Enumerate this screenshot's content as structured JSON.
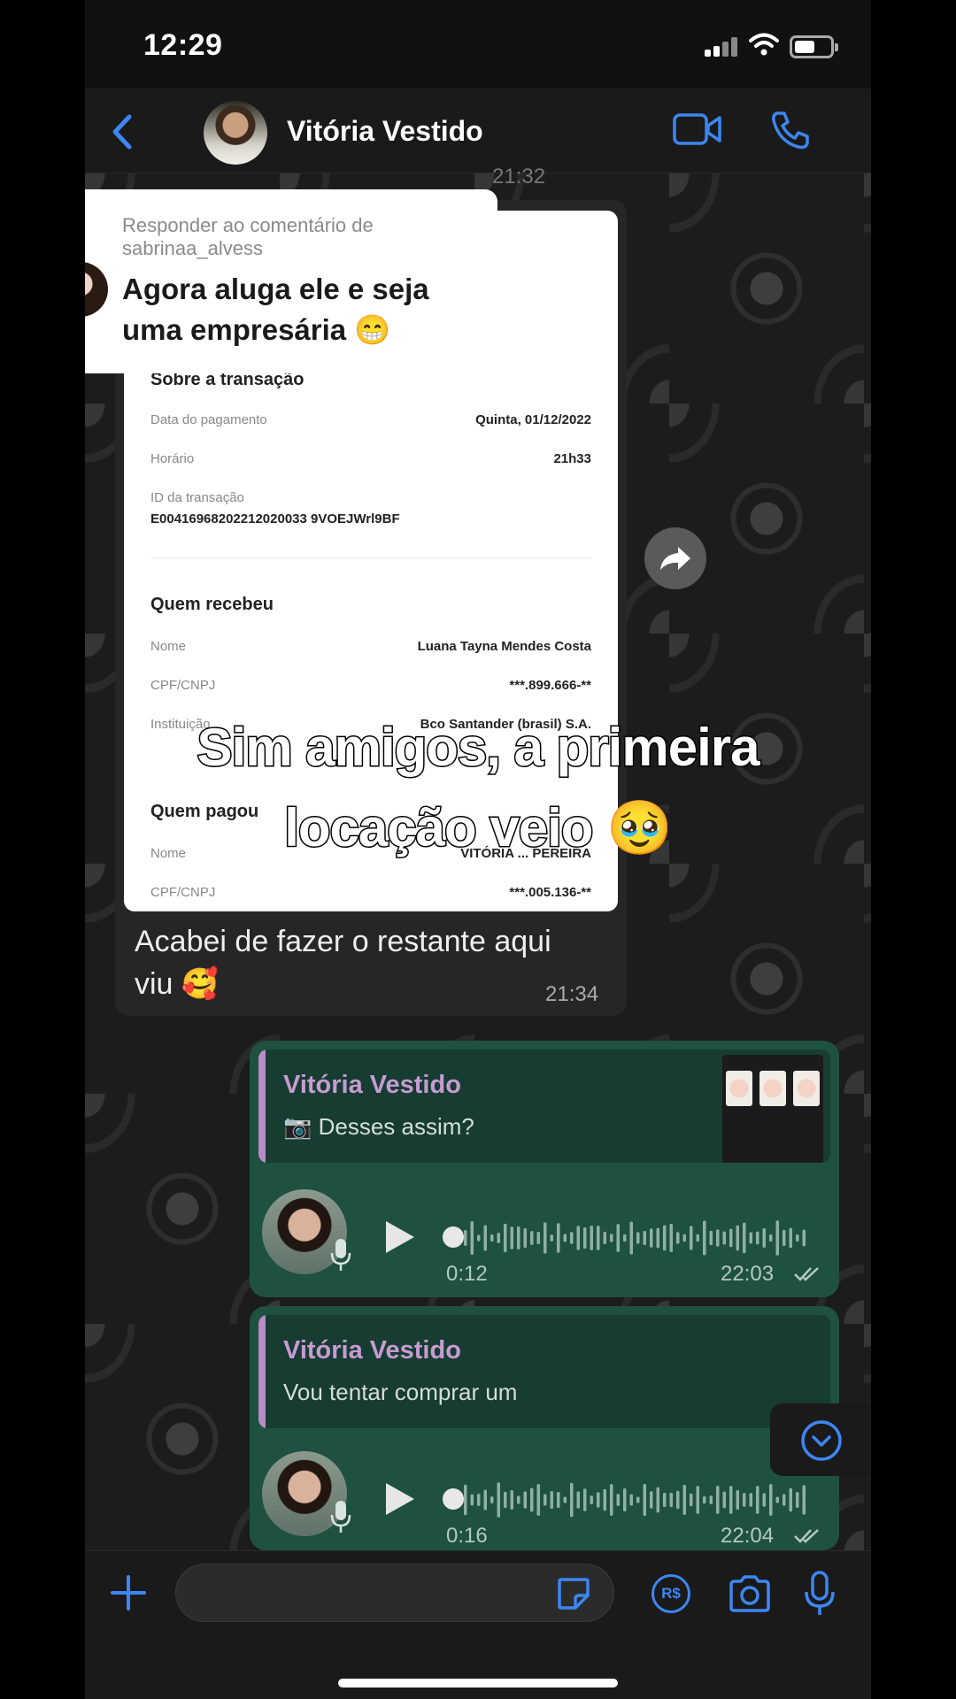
{
  "status_bar": {
    "time": "12:29"
  },
  "header": {
    "contact_name": "Vitória Vestido"
  },
  "incoming": {
    "previous_time": "21:32",
    "receipt": {
      "section_transaction": "Sobre a transação",
      "payment_date_label": "Data do pagamento",
      "payment_date_value": "Quinta, 01/12/2022",
      "time_label": "Horário",
      "time_value": "21h33",
      "transaction_id_label": "ID da transação",
      "transaction_id_value": "E00416968202212020033 9VOEJWrl9BF",
      "section_receiver": "Quem recebeu",
      "name_label": "Nome",
      "name_value": "Luana Tayna Mendes Costa",
      "cpf_label": "CPF/CNPJ",
      "cpf_value": "***.899.666-**",
      "institution_label": "Instituição",
      "institution_value": "Bco Santander (brasil) S.A.",
      "section_payer": "Quem pagou",
      "payer_name_label": "Nome",
      "payer_name_value": "VITÓRIA ... PEREIRA",
      "payer_cpf_label": "CPF/CNPJ",
      "payer_cpf_value": "***.005.136-**"
    },
    "text": "Acabei de fazer o restante aqui viu 🥰",
    "time": "21:34"
  },
  "reply_comment": {
    "header": "Responder ao comentário de sabrinaa_alvess",
    "comment": "Agora aluga ele e seja uma empresária 😁"
  },
  "caption": {
    "line1": "Sim amigos, a primeira",
    "line2": "locação veio 🥹"
  },
  "outgoing_1": {
    "quote_name": "Vitória Vestido",
    "quote_text": "📷 Desses assim?",
    "audio_duration": "0:12",
    "audio_time": "22:03"
  },
  "outgoing_2": {
    "quote_name": "Vitória Vestido",
    "quote_text": "Vou tentar comprar um",
    "audio_duration": "0:16",
    "audio_time": "22:04"
  },
  "input": {
    "placeholder": "",
    "pix_label": "R$"
  },
  "colors": {
    "accent": "#3d86f2",
    "outgoing_bubble": "#1f5140",
    "quote_name": "#c79bd3"
  },
  "icons": [
    "back-icon",
    "video-call-icon",
    "phone-call-icon",
    "forward-icon",
    "play-icon",
    "mic-icon",
    "double-check-icon",
    "chevron-down-icon",
    "plus-icon",
    "sticker-icon",
    "pix-icon",
    "camera-icon"
  ]
}
